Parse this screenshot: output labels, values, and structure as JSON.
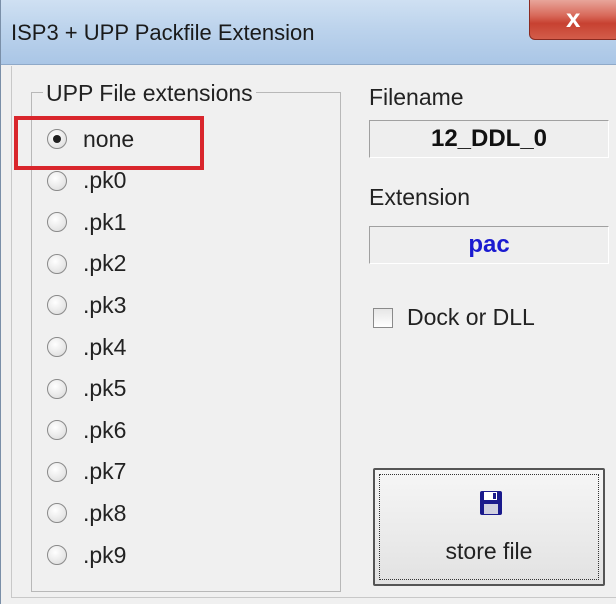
{
  "window": {
    "title": "ISP3 + UPP Packfile Extension",
    "close_glyph": "x"
  },
  "group": {
    "legend": "UPP File extensions",
    "options": [
      {
        "label": "none",
        "selected": true
      },
      {
        "label": ".pk0",
        "selected": false
      },
      {
        "label": ".pk1",
        "selected": false
      },
      {
        "label": ".pk2",
        "selected": false
      },
      {
        "label": ".pk3",
        "selected": false
      },
      {
        "label": ".pk4",
        "selected": false
      },
      {
        "label": ".pk5",
        "selected": false
      },
      {
        "label": ".pk6",
        "selected": false
      },
      {
        "label": ".pk7",
        "selected": false
      },
      {
        "label": ".pk8",
        "selected": false
      },
      {
        "label": ".pk9",
        "selected": false
      }
    ]
  },
  "filename": {
    "label": "Filename",
    "value": "12_DDL_0"
  },
  "extension": {
    "label": "Extension",
    "value": "pac",
    "value_color": "#1a1ad0"
  },
  "dock": {
    "label": "Dock or DLL",
    "checked": false
  },
  "store": {
    "label": "store file",
    "icon": "floppy-disk-icon",
    "icon_color": "#1a1a8c"
  },
  "highlight_color": "#d9262c"
}
